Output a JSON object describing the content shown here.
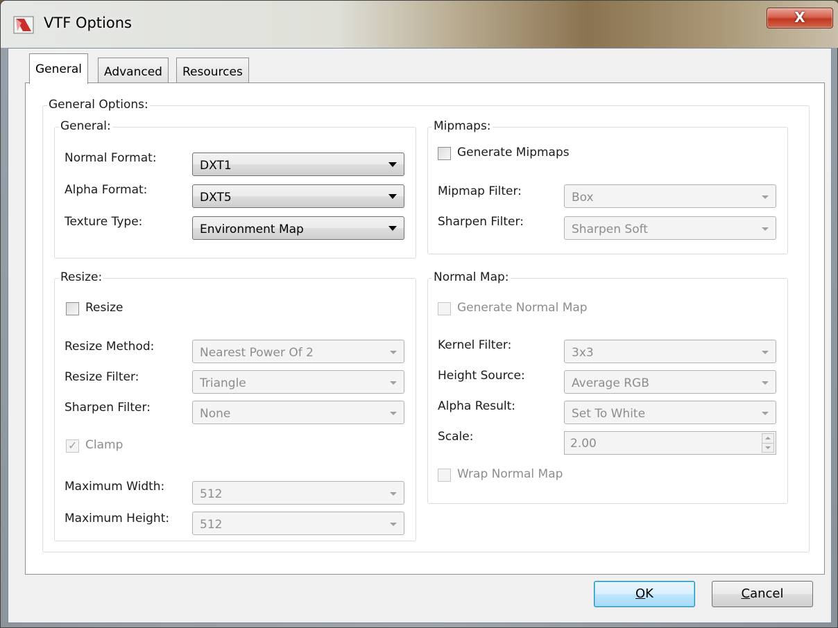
{
  "window": {
    "title": "VTF Options",
    "close_glyph": "X"
  },
  "tabs": [
    {
      "label": "General",
      "active": true
    },
    {
      "label": "Advanced",
      "active": false
    },
    {
      "label": "Resources",
      "active": false
    }
  ],
  "general_options": {
    "label": "General Options:",
    "general": {
      "label": "General:",
      "normal_format": {
        "label": "Normal Format:",
        "value": "DXT1"
      },
      "alpha_format": {
        "label": "Alpha Format:",
        "value": "DXT5"
      },
      "texture_type": {
        "label": "Texture Type:",
        "value": "Environment Map"
      }
    },
    "resize": {
      "label": "Resize:",
      "resize_check": {
        "label": "Resize",
        "checked": false
      },
      "resize_method": {
        "label": "Resize Method:",
        "value": "Nearest Power Of 2"
      },
      "resize_filter": {
        "label": "Resize Filter:",
        "value": "Triangle"
      },
      "sharpen_filter": {
        "label": "Sharpen Filter:",
        "value": "None"
      },
      "clamp": {
        "label": "Clamp",
        "checked": true,
        "mark": "✓"
      },
      "max_width": {
        "label": "Maximum Width:",
        "value": "512"
      },
      "max_height": {
        "label": "Maximum Height:",
        "value": "512"
      }
    },
    "mipmaps": {
      "label": "Mipmaps:",
      "generate": {
        "label": "Generate Mipmaps",
        "checked": false
      },
      "mipmap_filter": {
        "label": "Mipmap Filter:",
        "value": "Box"
      },
      "sharpen_filter": {
        "label": "Sharpen Filter:",
        "value": "Sharpen Soft"
      }
    },
    "normal_map": {
      "label": "Normal Map:",
      "generate": {
        "label": "Generate Normal Map",
        "checked": false
      },
      "kernel_filter": {
        "label": "Kernel Filter:",
        "value": "3x3"
      },
      "height_source": {
        "label": "Height Source:",
        "value": "Average RGB"
      },
      "alpha_result": {
        "label": "Alpha Result:",
        "value": "Set To White"
      },
      "scale": {
        "label": "Scale:",
        "value": "2.00"
      },
      "wrap": {
        "label": "Wrap Normal Map",
        "checked": false
      }
    }
  },
  "buttons": {
    "ok_prefix": "O",
    "ok_rest": "K",
    "cancel_prefix": "C",
    "cancel_rest": "ancel"
  },
  "colors": {
    "default_button": "#a7d9f5",
    "close_button": "#c0381f"
  }
}
